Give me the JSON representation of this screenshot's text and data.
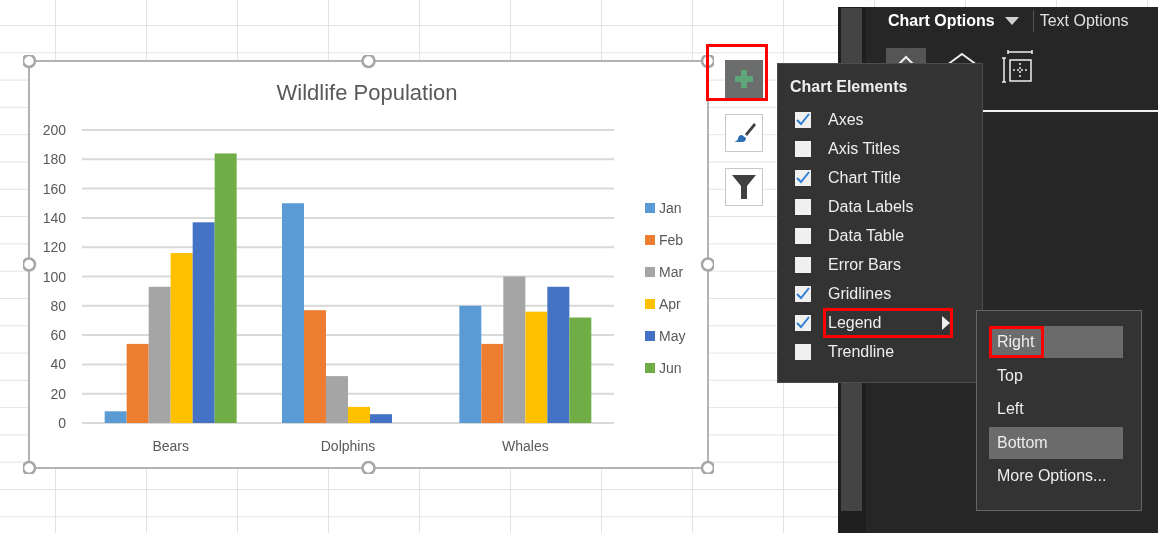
{
  "chart": {
    "selected": true,
    "chart_data": {
      "type": "bar",
      "title": "Wildlife Population",
      "categories": [
        "Bears",
        "Dolphins",
        "Whales"
      ],
      "series": [
        {
          "name": "Jan",
          "color": "#5b9bd5",
          "values": [
            8,
            150,
            80
          ]
        },
        {
          "name": "Feb",
          "color": "#ed7d31",
          "values": [
            54,
            77,
            54
          ]
        },
        {
          "name": "Mar",
          "color": "#a5a5a5",
          "values": [
            93,
            32,
            100
          ]
        },
        {
          "name": "Apr",
          "color": "#ffc000",
          "values": [
            116,
            11,
            76
          ]
        },
        {
          "name": "May",
          "color": "#4472c4",
          "values": [
            137,
            6,
            93
          ]
        },
        {
          "name": "Jun",
          "color": "#70ad47",
          "values": [
            184,
            0,
            72
          ]
        }
      ],
      "grid": true,
      "legend": "right",
      "ylim": [
        0,
        200
      ],
      "yticks": [
        0,
        20,
        40,
        60,
        80,
        100,
        120,
        140,
        160,
        180,
        200
      ]
    }
  },
  "chart_buttons": [
    {
      "kind": "add",
      "active": true,
      "outlined": true
    },
    {
      "kind": "style",
      "active": false,
      "outlined": false
    },
    {
      "kind": "filter",
      "active": false,
      "outlined": false
    }
  ],
  "chart_elements": {
    "title": "Chart Elements",
    "items": [
      {
        "label": "Axes",
        "checked": true,
        "has_submenu": false,
        "outlined": false
      },
      {
        "label": "Axis Titles",
        "checked": false,
        "has_submenu": false,
        "outlined": false
      },
      {
        "label": "Chart Title",
        "checked": true,
        "has_submenu": false,
        "outlined": false
      },
      {
        "label": "Data Labels",
        "checked": false,
        "has_submenu": false,
        "outlined": false
      },
      {
        "label": "Data Table",
        "checked": false,
        "has_submenu": false,
        "outlined": false
      },
      {
        "label": "Error Bars",
        "checked": false,
        "has_submenu": false,
        "outlined": false
      },
      {
        "label": "Gridlines",
        "checked": true,
        "has_submenu": false,
        "outlined": false
      },
      {
        "label": "Legend",
        "checked": true,
        "has_submenu": true,
        "outlined": true
      },
      {
        "label": "Trendline",
        "checked": false,
        "has_submenu": false,
        "outlined": false
      }
    ]
  },
  "legend_submenu": {
    "items": [
      {
        "label": "Right",
        "highlighted": true,
        "outlined": true
      },
      {
        "label": "Top",
        "highlighted": false,
        "outlined": false
      },
      {
        "label": "Left",
        "highlighted": false,
        "outlined": false
      },
      {
        "label": "Bottom",
        "highlighted": true,
        "outlined": false
      },
      {
        "label": "More Options...",
        "highlighted": false,
        "outlined": false
      }
    ]
  },
  "format_pane": {
    "tabs": [
      {
        "label": "Chart Options",
        "selected": true,
        "dropdown": true
      },
      {
        "label": "Text Options",
        "selected": false,
        "dropdown": false
      }
    ],
    "icon_tabs": [
      {
        "kind": "fill",
        "selected": true
      },
      {
        "kind": "effects",
        "selected": false
      },
      {
        "kind": "size",
        "selected": false
      }
    ]
  }
}
